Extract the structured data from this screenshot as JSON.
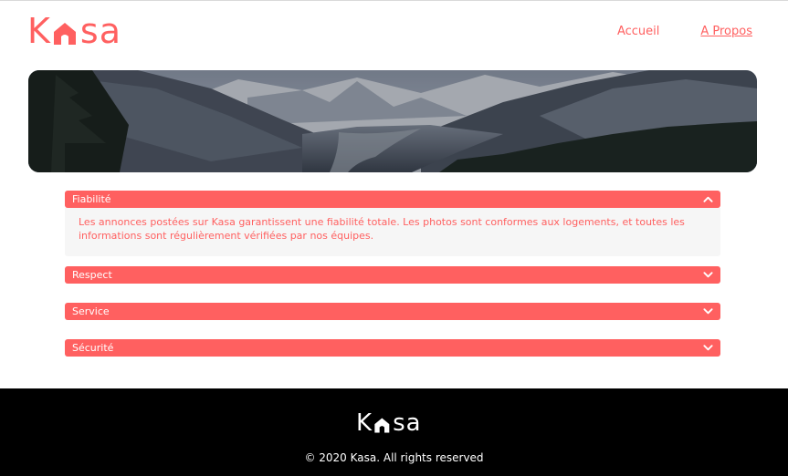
{
  "brand": {
    "logo_k": "K",
    "logo_rest": "sa",
    "accent_color": "#ff6060",
    "logo_icon": "house-icon"
  },
  "nav": {
    "items": [
      {
        "label": "Accueil",
        "active": false
      },
      {
        "label": "A Propos",
        "active": true
      }
    ]
  },
  "banner": {
    "image": "mountain-landscape-banner"
  },
  "collapses": [
    {
      "title": "Fiabilité",
      "expanded": true,
      "icon": "chevron-up-icon",
      "content": "Les annonces postées sur Kasa garantissent une fiabilité totale. Les photos sont conformes aux logements, et toutes les informations sont régulièrement vérifiées par nos équipes."
    },
    {
      "title": "Respect",
      "expanded": false,
      "icon": "chevron-down-icon"
    },
    {
      "title": "Service",
      "expanded": false,
      "icon": "chevron-down-icon"
    },
    {
      "title": "Sécurité",
      "expanded": false,
      "icon": "chevron-down-icon"
    }
  ],
  "footer": {
    "logo_k": "K",
    "logo_rest": "sa",
    "copyright": "© 2020 Kasa. All rights reserved"
  }
}
